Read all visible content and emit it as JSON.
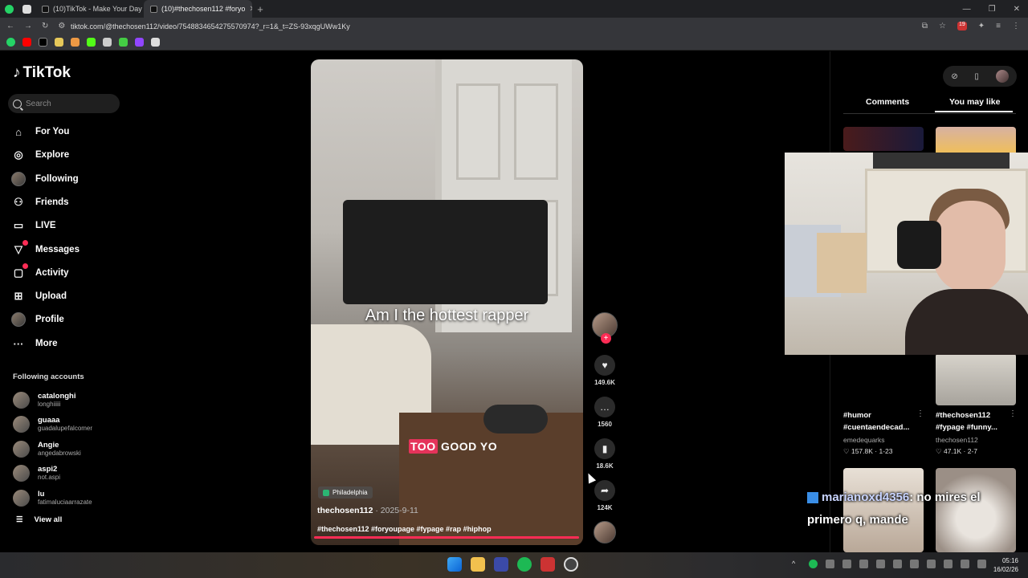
{
  "browser": {
    "tabs": [
      {
        "label": "(10)TikTok - Make Your Day",
        "active": false
      },
      {
        "label": "(10)#thechosen112 #foryo",
        "active": true
      }
    ],
    "url": "tiktok.com/@thechosen112/video/7548834654275570974?_r=1&_t=ZS-93xqgUWw1Ky",
    "ext_badge": "19"
  },
  "sidebar": {
    "logo": "TikTok",
    "search_placeholder": "Search",
    "nav": [
      {
        "label": "For You",
        "icon": "home-icon"
      },
      {
        "label": "Explore",
        "icon": "compass-icon"
      },
      {
        "label": "Following",
        "icon": "avatar-icon"
      },
      {
        "label": "Friends",
        "icon": "friends-icon"
      },
      {
        "label": "LIVE",
        "icon": "live-icon"
      },
      {
        "label": "Messages",
        "icon": "messages-icon",
        "badge": true
      },
      {
        "label": "Activity",
        "icon": "activity-icon",
        "badge": true
      },
      {
        "label": "Upload",
        "icon": "upload-icon"
      },
      {
        "label": "Profile",
        "icon": "profile-avatar-icon"
      },
      {
        "label": "More",
        "icon": "more-icon"
      }
    ],
    "following_title": "Following accounts",
    "following": [
      {
        "name": "catalonghi",
        "handle": "longhiiiii"
      },
      {
        "name": "guaaa",
        "handle": "guadalupefalcomer"
      },
      {
        "name": "Angie",
        "handle": "angedabrowski"
      },
      {
        "name": "aspi2",
        "handle": "not.aspi"
      },
      {
        "name": "lu",
        "handle": "fatimaluciaarrazate"
      }
    ],
    "view_all": "View all"
  },
  "video": {
    "caption": "Am I the hottest rapper",
    "subtitle_highlight": "TOO",
    "subtitle_rest": " GOOD YO",
    "location": "Philadelphia",
    "author": "thechosen112",
    "date": "· 2025-9-11",
    "hashtags": "#thechosen112 #foryoupage #fypage #rap #hiphop",
    "progress": 1.0
  },
  "actions": {
    "likes": "149.6K",
    "comments": "1560",
    "saves": "18.6K",
    "shares": "124K"
  },
  "right_panel": {
    "tab_comments": "Comments",
    "tab_you_may_like": "You may like",
    "cards": [
      {
        "caption_line1": "#humor",
        "caption_line2": "#cuentaendecad...",
        "user": "emedequarks",
        "stats": "♡ 157.8K · 1-23"
      },
      {
        "caption_line1": "#thechosen112",
        "caption_line2": "#fypage #funny...",
        "user": "thechosen112",
        "stats": "♡ 47.1K · 2-7"
      }
    ]
  },
  "chat_overlay": {
    "username": "marianoxd4356",
    "message_part1": ": no mires el",
    "message_part2": "primero q, mande"
  },
  "taskbar": {
    "time": "05:16",
    "date": "16/02/26"
  }
}
